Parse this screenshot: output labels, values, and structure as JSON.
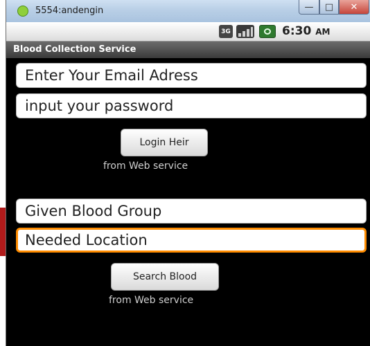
{
  "window": {
    "title": "5554:andengin",
    "minimize_glyph": "—",
    "maximize_glyph": "□",
    "close_glyph": "✕"
  },
  "status_bar": {
    "network_label": "3G",
    "time": "6:30",
    "ampm": "AM"
  },
  "app": {
    "title": "Blood Collection Service"
  },
  "login": {
    "email_placeholder": "Enter Your Email Adress",
    "password_placeholder": "input your password",
    "button_label": "Login Heir",
    "caption": "from Web service"
  },
  "search": {
    "blood_group_placeholder": "Given Blood Group",
    "location_placeholder": "Needed Location",
    "button_label": "Search Blood",
    "caption": "from Web service"
  },
  "colors": {
    "focus_border": "#ff8c00",
    "app_background": "#000000"
  },
  "icons": [
    "android-app-icon",
    "network-3g-icon",
    "signal-icon",
    "battery-icon"
  ]
}
